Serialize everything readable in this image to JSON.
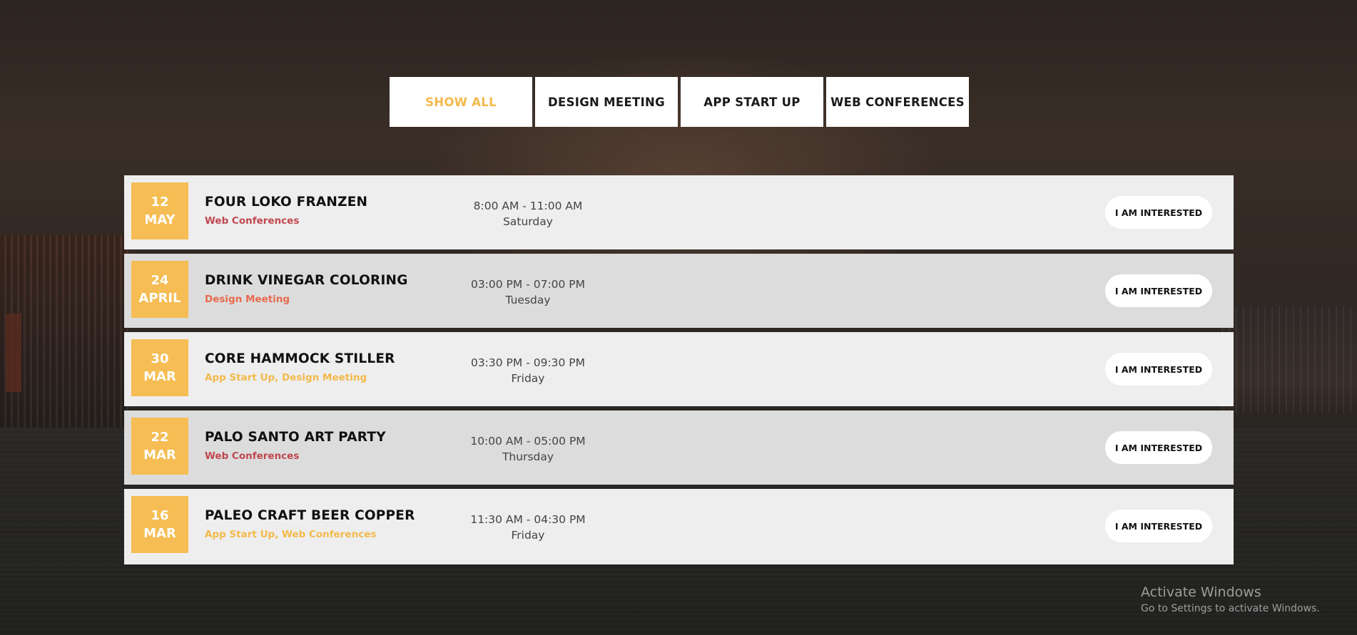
{
  "filters": [
    {
      "label": "SHOW ALL",
      "active": true
    },
    {
      "label": "DESIGN MEETING",
      "active": false
    },
    {
      "label": "APP START UP",
      "active": false
    },
    {
      "label": "WEB CONFERENCES",
      "active": false
    }
  ],
  "events": [
    {
      "day": "12",
      "month": "MAY",
      "title": "FOUR LOKO FRANZEN",
      "categories": "Web Conferences",
      "time": "8:00 AM - 11:00 AM",
      "weekday": "Saturday",
      "button": "I AM INTERESTED"
    },
    {
      "day": "24",
      "month": "APRIL",
      "title": "DRINK VINEGAR COLORING",
      "categories": "Design Meeting",
      "time": "03:00 PM - 07:00 PM",
      "weekday": "Tuesday",
      "button": "I AM INTERESTED"
    },
    {
      "day": "30",
      "month": "MAR",
      "title": "CORE HAMMOCK STILLER",
      "categories": "App Start Up, Design Meeting",
      "time": "03:30 PM - 09:30 PM",
      "weekday": "Friday",
      "button": "I AM INTERESTED"
    },
    {
      "day": "22",
      "month": "MAR",
      "title": "PALO SANTO ART PARTY",
      "categories": "Web Conferences",
      "time": "10:00 AM - 05:00 PM",
      "weekday": "Thursday",
      "button": "I AM INTERESTED"
    },
    {
      "day": "16",
      "month": "MAR",
      "title": "PALEO CRAFT BEER COPPER",
      "categories": "App Start Up, Web Conferences",
      "time": "11:30 AM - 04:30 PM",
      "weekday": "Friday",
      "button": "I AM INTERESTED"
    }
  ],
  "watermark": {
    "title": "Activate Windows",
    "subtitle": "Go to Settings to activate Windows."
  },
  "colors": {
    "accent": "#f5bd53",
    "active_filter": "#f3b94b",
    "web_conferences": "#c0474f",
    "design_meeting": "#e86a4e",
    "app_start_up": "#f3b94b",
    "row_light": "#eeeeee",
    "row_dark": "#dcdcdc"
  }
}
